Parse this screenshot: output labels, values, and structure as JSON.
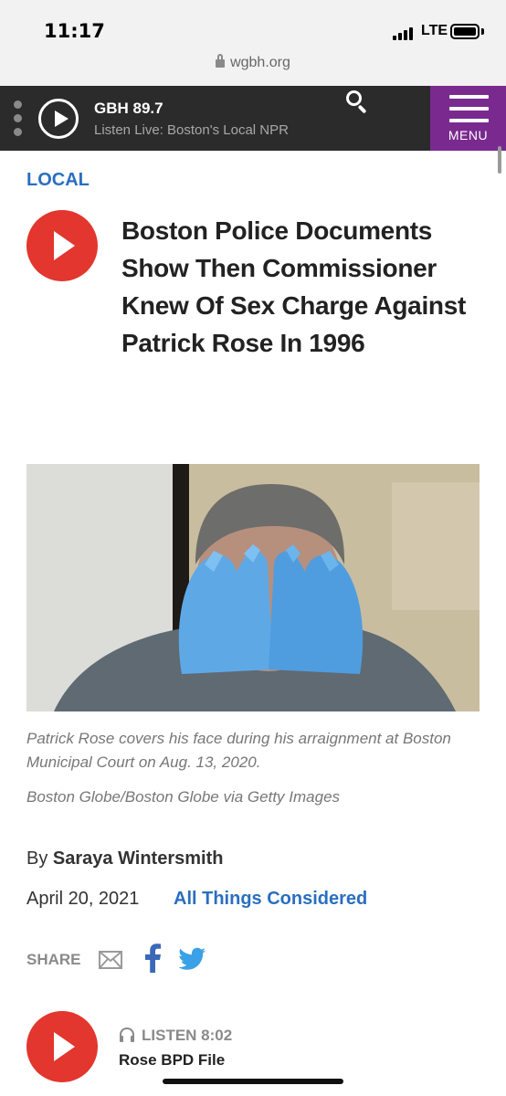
{
  "status_bar": {
    "time": "11:17",
    "network": "LTE",
    "url": "wgbh.org"
  },
  "radio": {
    "station": "GBH 89.7",
    "subtitle": "Listen Live: Boston's Local NPR",
    "menu_label": "MENU",
    "menu_color": "#7a2a8f"
  },
  "article": {
    "category": "LOCAL",
    "headline": "Boston Police Documents Show Then Commissioner Knew Of Sex Charge Against Patrick Rose In 1996",
    "photo_caption": "Patrick Rose covers his face during his arraignment at Boston Municipal Court on Aug. 13, 2020.",
    "photo_credit": "Boston Globe/Boston Globe via Getty Images",
    "byline_prefix": "By",
    "author": "Saraya Wintersmith",
    "date": "April 20, 2021",
    "program": "All Things Considered"
  },
  "share": {
    "label": "SHARE",
    "icons": [
      "mail-icon",
      "facebook-icon",
      "twitter-icon"
    ]
  },
  "audio": {
    "label": "LISTEN 8:02",
    "title": "Rose BPD File"
  },
  "colors": {
    "accent_blue": "#2a6fc0",
    "play_red": "#e2362e",
    "header_dark": "#2b2b2b"
  }
}
